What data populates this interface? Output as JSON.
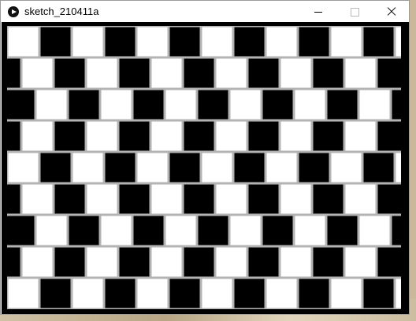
{
  "window": {
    "title": "sketch_210411a",
    "icon": "processing-app-icon",
    "controls": [
      "minimize",
      "maximize",
      "close"
    ]
  },
  "sketch": {
    "description_colors": {
      "background": "#b3b3b3",
      "dark": "#000000",
      "light": "#ffffff"
    }
  }
}
